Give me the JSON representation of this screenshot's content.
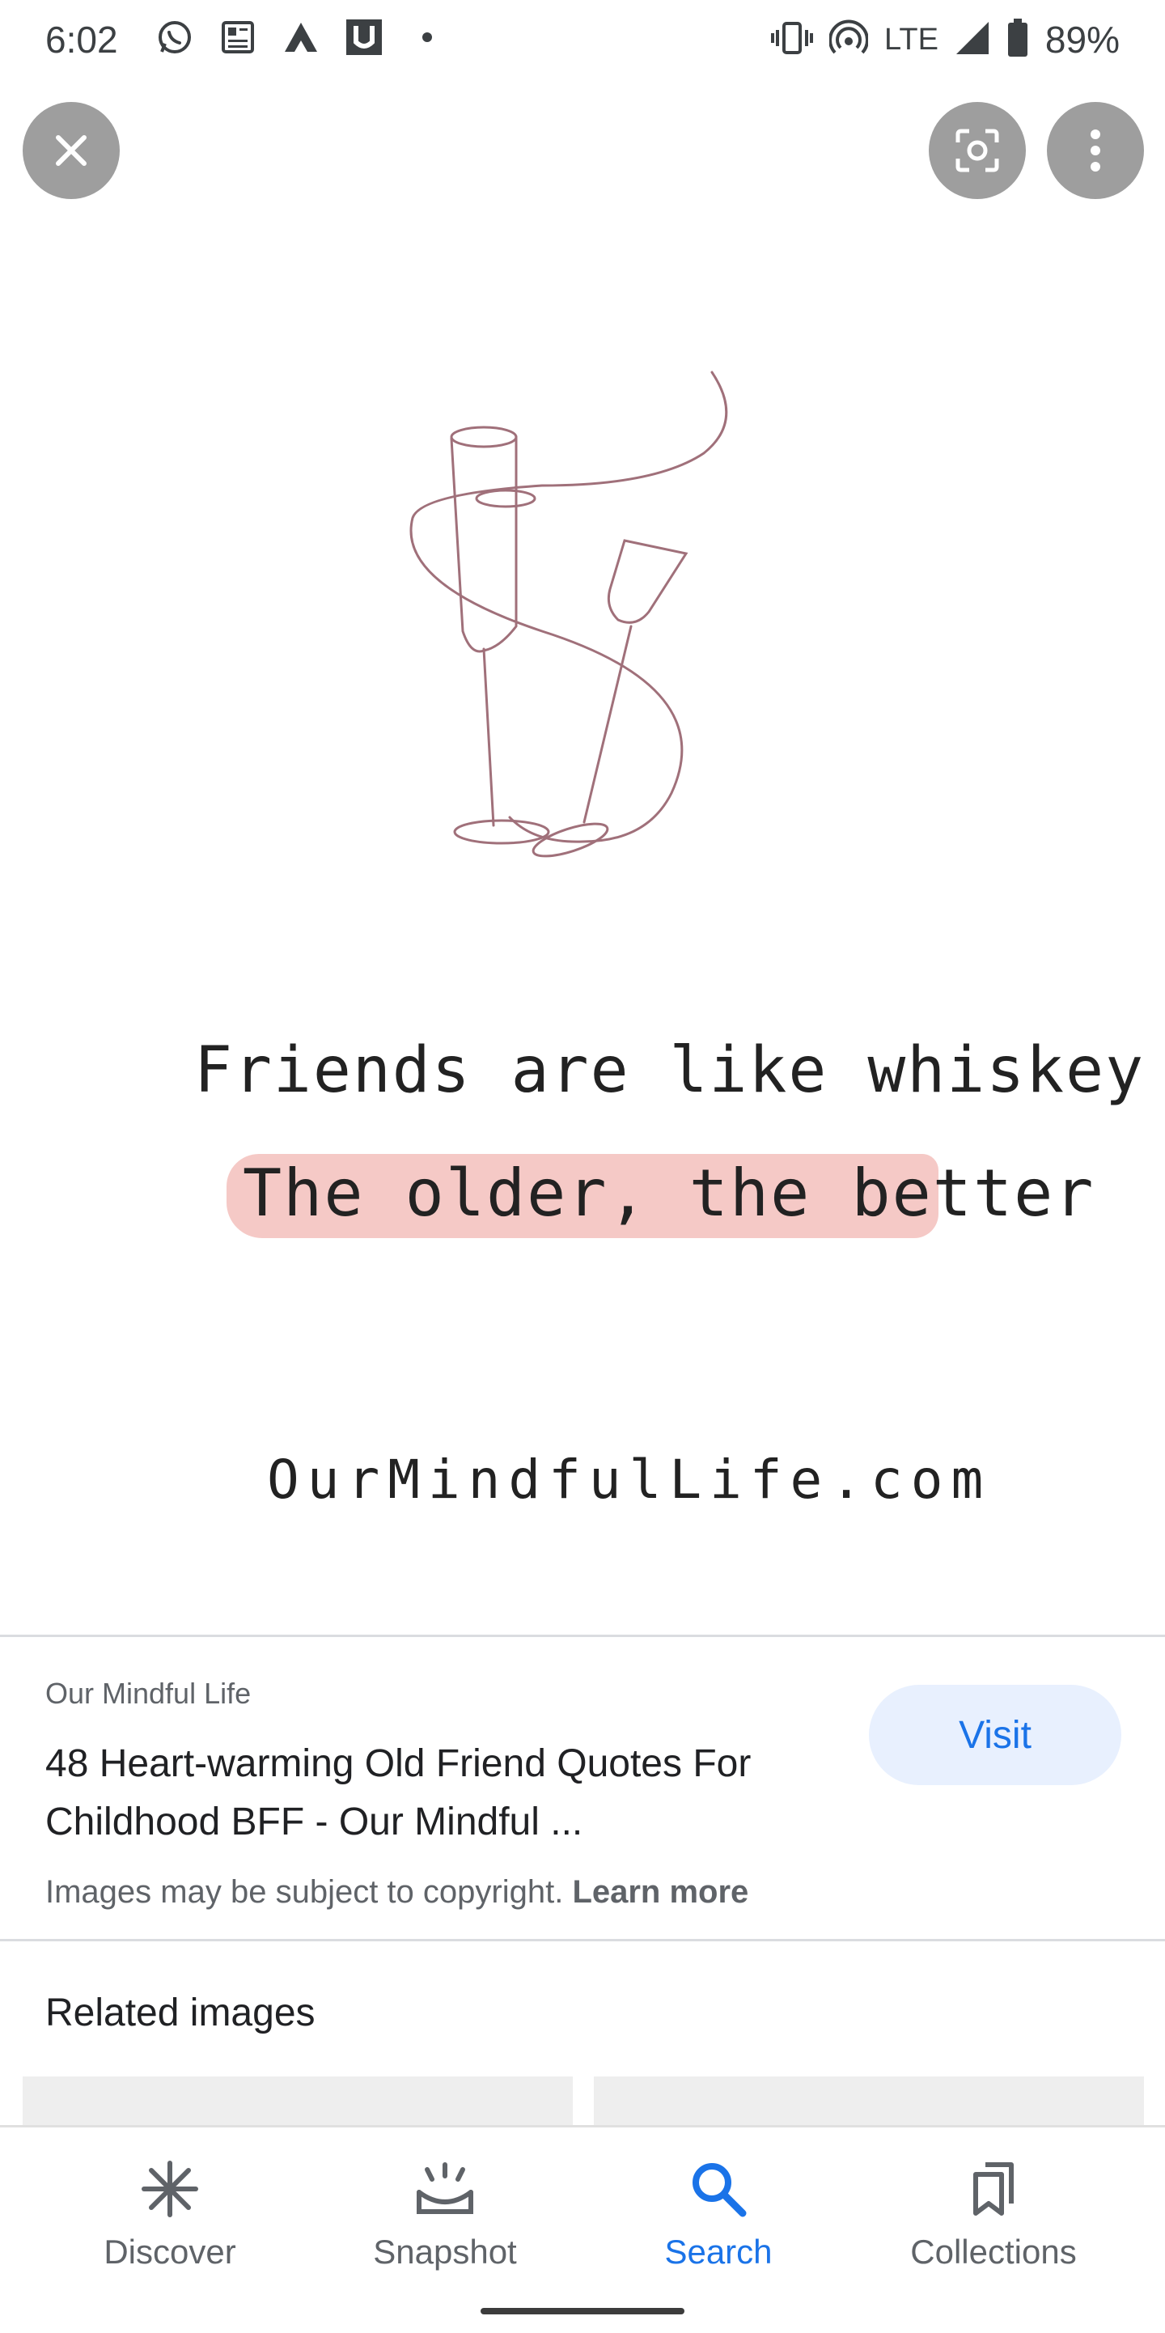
{
  "status_bar": {
    "time": "6:02",
    "network": "LTE",
    "battery": "89%",
    "left_icons": [
      "whatsapp-icon",
      "news-icon",
      "arc-icon",
      "u-app-icon",
      "dot-icon"
    ]
  },
  "image": {
    "quote_line1": "Friends are like whiskey",
    "quote_line2": "The older, the better",
    "site": "OurMindfulLife.com",
    "highlight_color": "#f4c6c3",
    "line_art_color": "#a0707a"
  },
  "result": {
    "source": "Our Mindful Life",
    "title": "48 Heart-warming Old Friend Quotes For Childhood BFF - Our Mindful ...",
    "visit_label": "Visit",
    "copyright_text": "Images may be subject to copyright.",
    "learn_more": "Learn more"
  },
  "related": {
    "title": "Related images"
  },
  "bottom_nav": {
    "items": [
      {
        "label": "Discover",
        "icon": "asterisk-icon",
        "active": false
      },
      {
        "label": "Snapshot",
        "icon": "snapshot-icon",
        "active": false
      },
      {
        "label": "Search",
        "icon": "search-icon",
        "active": true
      },
      {
        "label": "Collections",
        "icon": "bookmark-icon",
        "active": false
      }
    ]
  },
  "colors": {
    "accent": "#1a73e8",
    "visit_bg": "#e8f0fe",
    "top_button_bg": "#9e9e9e"
  }
}
